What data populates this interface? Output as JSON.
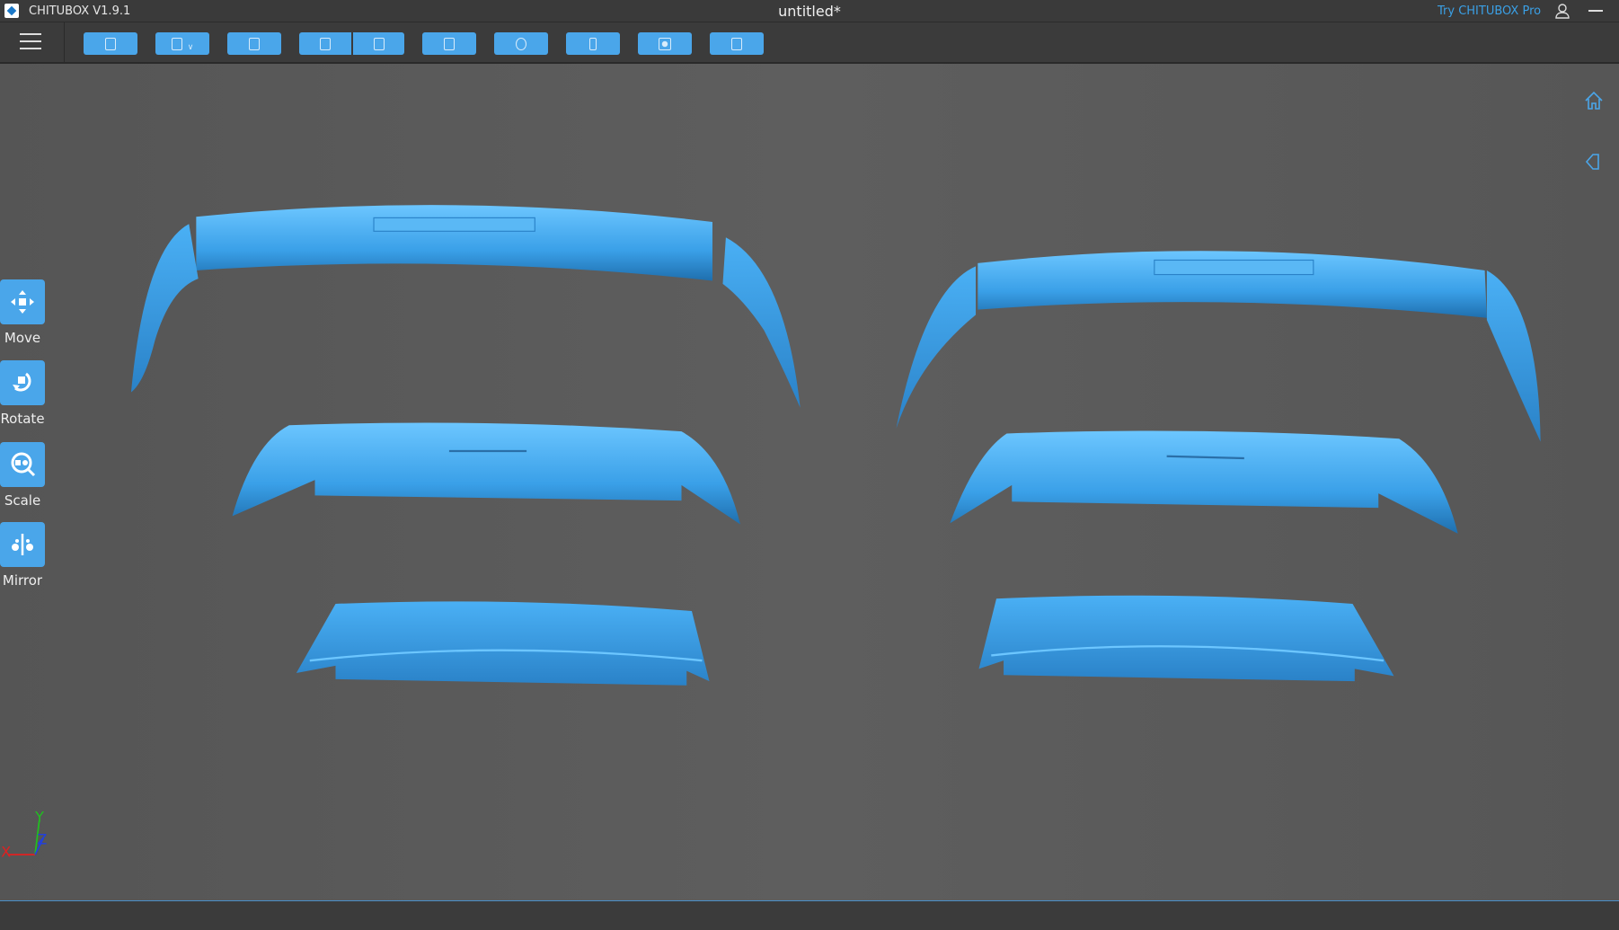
{
  "titlebar": {
    "app_name": "CHITUBOX V1.9.1",
    "document_title": "untitled*",
    "try_pro_label": "Try CHITUBOX Pro"
  },
  "toolbar": {
    "buttons": [
      {
        "name": "open-file"
      },
      {
        "name": "save"
      },
      {
        "name": "auto-layout"
      },
      {
        "name": "undo"
      },
      {
        "name": "redo"
      },
      {
        "name": "settings-list"
      },
      {
        "name": "duplicate"
      },
      {
        "name": "support"
      },
      {
        "name": "slice-preview"
      },
      {
        "name": "slice"
      }
    ]
  },
  "tools": [
    {
      "label": "Move",
      "icon": "move-icon"
    },
    {
      "label": "Rotate",
      "icon": "rotate-icon"
    },
    {
      "label": "Scale",
      "icon": "scale-icon"
    },
    {
      "label": "Mirror",
      "icon": "mirror-icon"
    }
  ],
  "axes": {
    "x": "X",
    "y": "Y",
    "z": "Z"
  },
  "colors": {
    "accent": "#4aa6ea",
    "model": "#3a9be0",
    "link": "#3aa0e6"
  }
}
